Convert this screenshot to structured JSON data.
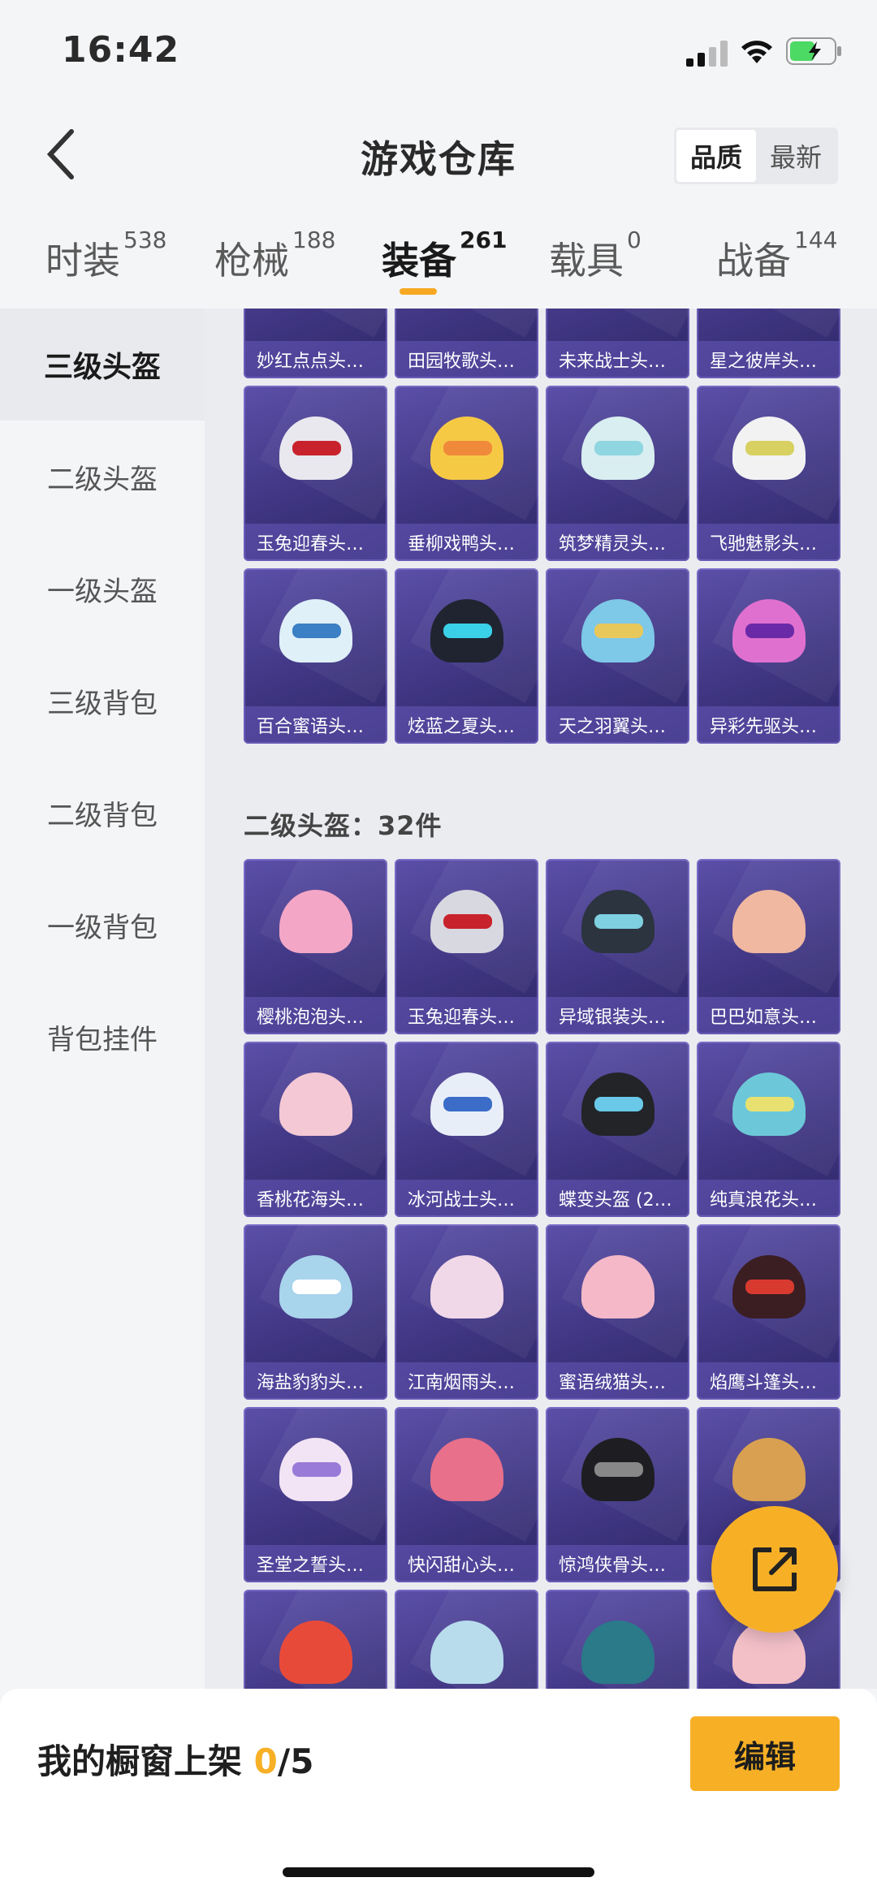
{
  "status_bar": {
    "time": "16:42"
  },
  "header": {
    "title": "游戏仓库",
    "sort_options": [
      "品质",
      "最新"
    ],
    "active_sort": "品质"
  },
  "tabs": [
    {
      "label": "时装",
      "count": "538"
    },
    {
      "label": "枪械",
      "count": "188"
    },
    {
      "label": "装备",
      "count": "261",
      "active": true
    },
    {
      "label": "载具",
      "count": "0"
    },
    {
      "label": "战备",
      "count": "144"
    }
  ],
  "sidebar": [
    {
      "label": "三级头盔",
      "active": true
    },
    {
      "label": "二级头盔"
    },
    {
      "label": "一级头盔"
    },
    {
      "label": "三级背包"
    },
    {
      "label": "二级背包"
    },
    {
      "label": "一级背包"
    },
    {
      "label": "背包挂件"
    }
  ],
  "level3": {
    "partial_row": [
      "妙红点点头…",
      "田园牧歌头…",
      "未来战士头…",
      "星之彼岸头…"
    ],
    "rows": [
      [
        "玉兔迎春头…",
        "垂柳戏鸭头…",
        "筑梦精灵头…",
        "飞驰魅影头…"
      ],
      [
        "百合蜜语头…",
        "炫蓝之夏头…",
        "天之羽翼头…",
        "异彩先驱头…"
      ]
    ]
  },
  "level2": {
    "title": "二级头盔：32件",
    "rows": [
      [
        "樱桃泡泡头…",
        "玉兔迎春头…",
        "异域银装头…",
        "巴巴如意头…"
      ],
      [
        "香桃花海头…",
        "冰河战士头…",
        "蝶变头盔 (2…",
        "纯真浪花头…"
      ],
      [
        "海盐豹豹头…",
        "江南烟雨头…",
        "蜜语绒猫头…",
        "焰鹰斗篷头…"
      ],
      [
        "圣堂之誓头…",
        "快闪甜心头…",
        "惊鸿侠骨头…",
        ""
      ]
    ]
  },
  "bottom": {
    "showcase_label": "我的橱窗上架 ",
    "showcase_count": "0",
    "showcase_total": "/5",
    "edit_label": "编辑"
  },
  "colors": {
    "accent": "#f7b026",
    "card_bg": "#403683"
  }
}
